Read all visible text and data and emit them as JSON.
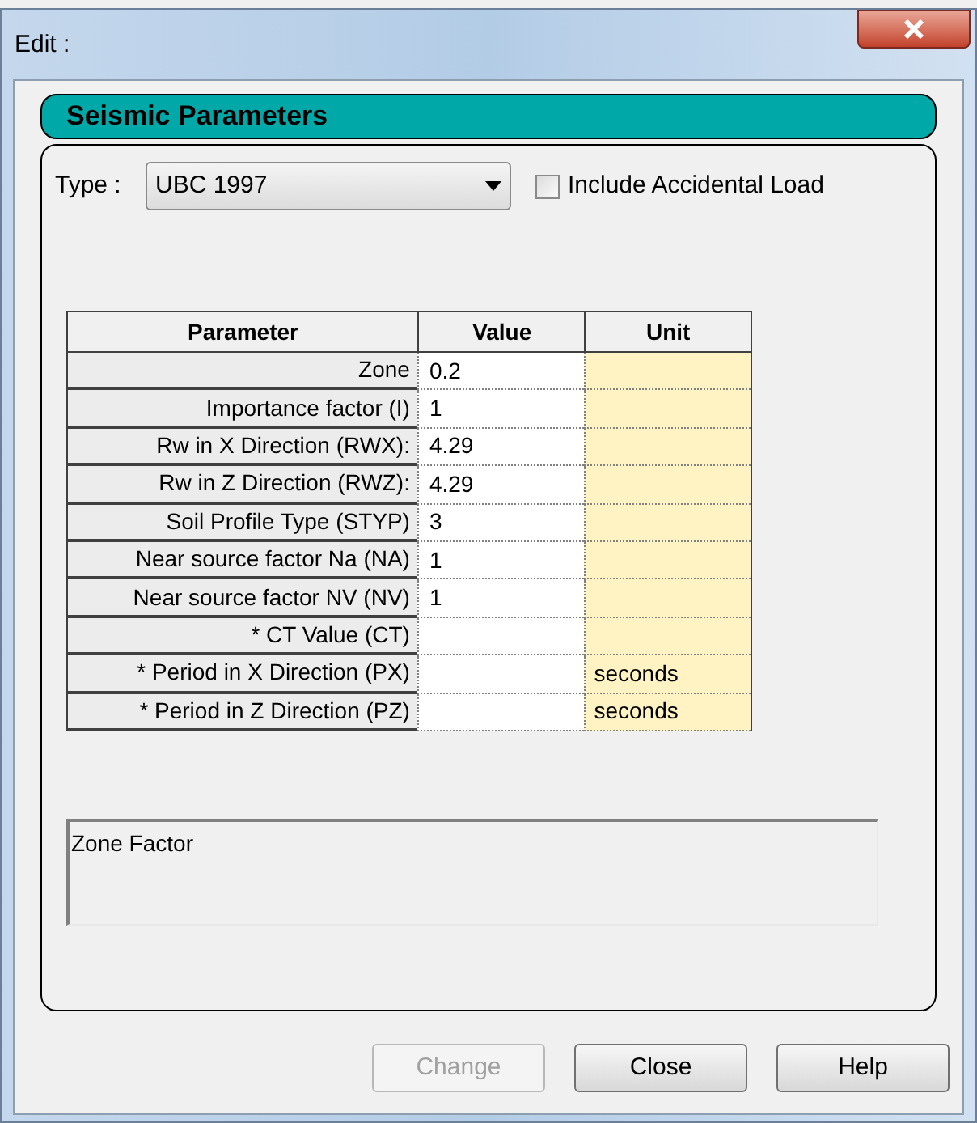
{
  "window": {
    "title": "Edit :"
  },
  "section": {
    "title": "Seismic Parameters"
  },
  "type_field": {
    "label": "Type :",
    "value": "UBC 1997"
  },
  "accidental_load": {
    "label": "Include Accidental Load",
    "checked": false
  },
  "table": {
    "columns": [
      "Parameter",
      "Value",
      "Unit"
    ],
    "rows": [
      {
        "parameter": "Zone",
        "value": "0.2"
      },
      {
        "parameter": "Importance factor (I)",
        "value": "1"
      },
      {
        "parameter": "Rw in X Direction (RWX):",
        "value": "4.29"
      },
      {
        "parameter": "Rw in Z Direction (RWZ):",
        "value": "4.29"
      },
      {
        "parameter": "Soil Profile Type (STYP)",
        "value": "3"
      },
      {
        "parameter": "Near source factor Na (NA)",
        "value": "1"
      },
      {
        "parameter": "Near source factor NV (NV)",
        "value": "1"
      },
      {
        "parameter": "* CT Value (CT)"
      },
      {
        "parameter": "* Period in X Direction (PX)",
        "unit": "seconds"
      },
      {
        "parameter": "* Period in Z Direction (PZ)",
        "unit": "seconds"
      }
    ]
  },
  "description": "Zone Factor",
  "buttons": [
    {
      "label": "Change",
      "disabled": true
    },
    {
      "label": "Close",
      "disabled": false
    },
    {
      "label": "Help",
      "disabled": false
    }
  ]
}
